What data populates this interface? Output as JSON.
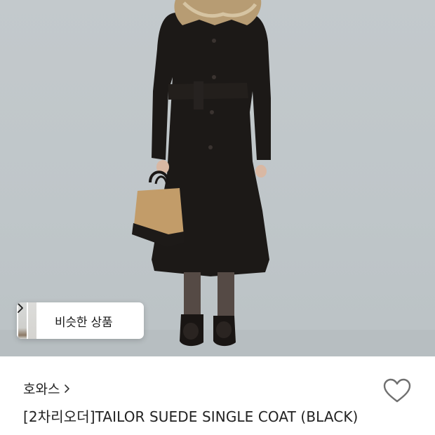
{
  "product_image": {
    "alt_icon": "product-photo"
  },
  "similar_products": {
    "label": "비슷한 상품",
    "icon": "chevron-right-icon"
  },
  "product": {
    "brand": "호와스",
    "brand_icon": "chevron-right-icon",
    "title": "[2차리오더]TAILOR SUEDE SINGLE COAT (BLACK)",
    "like_icon": "heart-outline-icon"
  },
  "colors": {
    "background": "#ffffff",
    "photo_backdrop": "#c1c7ca",
    "text_primary": "#222222",
    "icon_gray": "#6f6f6f"
  }
}
